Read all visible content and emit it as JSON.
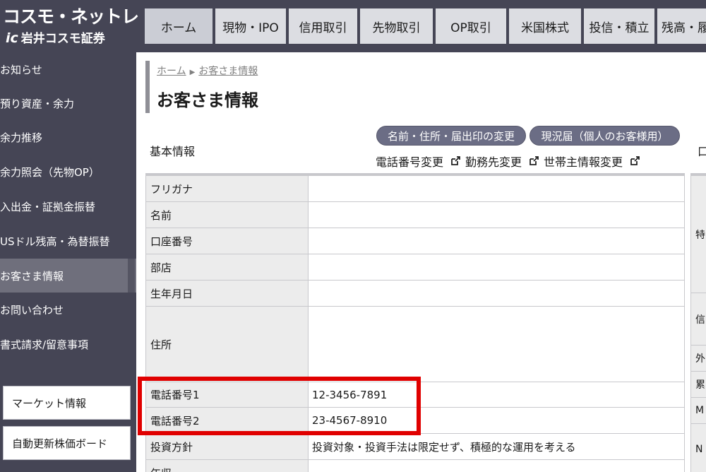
{
  "logo": {
    "name": "コスモ・ネットレ",
    "company_mark": "ic",
    "company": "岩井コスモ証券"
  },
  "nav": {
    "tabs": [
      {
        "label": "ホーム",
        "active": true
      },
      {
        "label": "現物・IPO"
      },
      {
        "label": "信用取引"
      },
      {
        "label": "先物取引"
      },
      {
        "label": "OP取引"
      },
      {
        "label": "米国株式"
      },
      {
        "label": "投信・積立"
      },
      {
        "label": "残高・履"
      }
    ]
  },
  "sidebar": {
    "items": [
      {
        "label": "お知らせ"
      },
      {
        "label": "預り資産・余力"
      },
      {
        "label": "余力推移"
      },
      {
        "label": "余力照会（先物OP）"
      },
      {
        "label": "入出金・証拠金振替"
      },
      {
        "label": "USドル残高・為替振替"
      },
      {
        "label": "お客さま情報",
        "active": true
      },
      {
        "label": "お問い合わせ"
      },
      {
        "label": "書式請求/留意事項"
      }
    ],
    "boxes": [
      {
        "label": "マーケット情報"
      },
      {
        "label": "自動更新株価ボード"
      }
    ]
  },
  "breadcrumb": {
    "home": "ホーム",
    "current": "お客さま情報"
  },
  "page": {
    "title": "お客さま情報"
  },
  "basic_info": {
    "section_label": "基本情報",
    "buttons": {
      "change_name": "名前・住所・届出印の変更",
      "status_report": "現況届（個人のお客様用）"
    },
    "links": {
      "phone_change": "電話番号変更",
      "work_change": "勤務先変更",
      "householder_change": "世帯主情報変更"
    },
    "rows": [
      {
        "label": "フリガナ",
        "value": ""
      },
      {
        "label": "名前",
        "value": ""
      },
      {
        "label": "口座番号",
        "value": ""
      },
      {
        "label": "部店",
        "value": ""
      },
      {
        "label": "生年月日",
        "value": ""
      },
      {
        "label": "住所",
        "value": ""
      },
      {
        "label": "電話番号1",
        "value": "12-3456-7891"
      },
      {
        "label": "電話番号2",
        "value": "23-4567-8910"
      },
      {
        "label": "投資方針",
        "value": "投資対象・投資手法は限定せず、積極的な運用を考える"
      },
      {
        "label": "年収",
        "value": ""
      }
    ]
  },
  "right_column": {
    "header": "口",
    "cells": [
      "特",
      "信",
      "外",
      "累",
      "M",
      "N"
    ]
  },
  "colors": {
    "header_bg": "#454555",
    "highlight": "#e00000",
    "pill_bg": "#6b6d85"
  }
}
